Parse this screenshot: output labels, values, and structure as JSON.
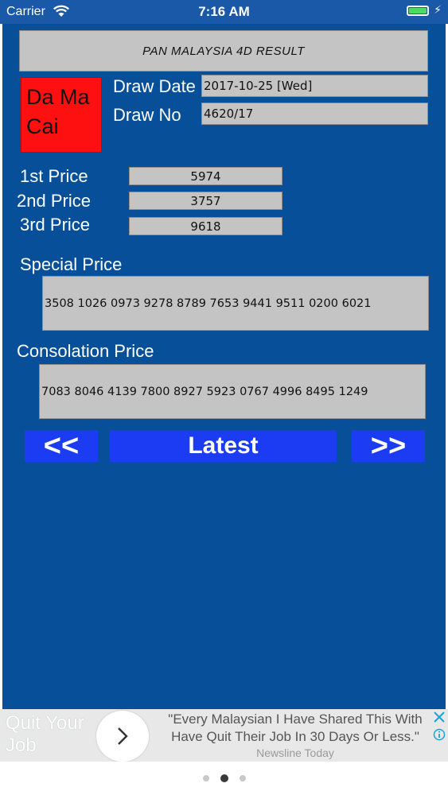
{
  "status_bar": {
    "carrier": "Carrier",
    "time": "7:16 AM",
    "battery_level": 1.0,
    "icons": [
      "wifi-icon",
      "battery-icon",
      "charging-icon"
    ]
  },
  "result": {
    "title": "PAN MALAYSIA 4D RESULT",
    "operator_name": "Da Ma Cai",
    "operator_color": "#ff1010",
    "draw_date_label": "Draw Date",
    "draw_date": "2017-10-25 [Wed]",
    "draw_no_label": "Draw No",
    "draw_no": "4620/17",
    "prizes": [
      {
        "label": "1st Price",
        "number": "5974"
      },
      {
        "label": "2nd Price",
        "number": "3757"
      },
      {
        "label": "3rd Price",
        "number": "9618"
      }
    ],
    "special_label": "Special Price",
    "special_numbers": "3508 1026 0973 9278 8789 7653 9441 9511 0200 6021",
    "consolation_label": "Consolation Price",
    "consolation_numbers": "7083 8046 4139 7800 8927 5923 0767 4996 8495 1249"
  },
  "navigation": {
    "prev_label": "<<",
    "latest_label": "Latest",
    "next_label": ">>"
  },
  "ad": {
    "title": "Quit Your Job",
    "text": "\"Every Malaysian I Have Shared This With Have Quit Their Job In 30 Days Or Less.\"",
    "source": "Newsline Today",
    "icons": [
      "chevron-right-icon",
      "close-icon",
      "info-icon"
    ]
  },
  "pager": {
    "count": 3,
    "active_index": 1
  },
  "colors": {
    "background": "#075099",
    "status_bar": "#1a58a8",
    "nav_button": "#1b3cf3",
    "field": "#c4c4c4"
  }
}
